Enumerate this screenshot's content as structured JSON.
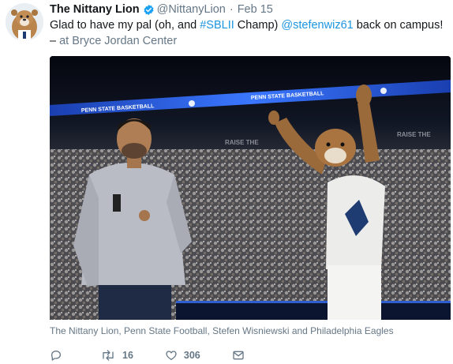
{
  "tweet": {
    "display_name": "The Nittany Lion",
    "handle": "@NittanyLion",
    "separator": "·",
    "time": "Feb 15",
    "text_part1": "Glad to have my pal (oh, and ",
    "hashtag": "#SBLII",
    "text_part2": " Champ) ",
    "mention": "@stefenwiz61",
    "text_part3": " back on campus! – ",
    "location": "at Bryce Jordan Center",
    "media_caption": "The Nittany Lion, Penn State Football, Stefen Wisniewski and Philadelphia Eagles",
    "media_banner_1": "PENN STATE BASKETBALL",
    "media_banner_2": "PENN STATE BASKETBALL",
    "media_banner_3": "RAISE THE",
    "media_banner_4": "RAISE THE",
    "actions": {
      "reply_count": "",
      "retweet_count": "16",
      "like_count": "306"
    }
  },
  "colors": {
    "link": "#1b95e0",
    "secondary": "#657786",
    "verified": "#1da1f2"
  },
  "icons": [
    "avatar-lion",
    "verified-badge-icon",
    "reply-icon",
    "retweet-icon",
    "like-icon",
    "message-icon"
  ]
}
